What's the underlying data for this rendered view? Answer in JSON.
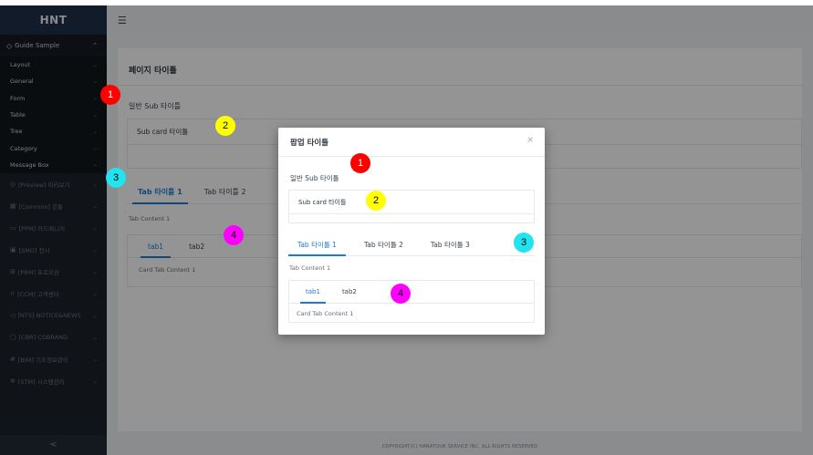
{
  "brand": {
    "name": "HNT"
  },
  "sidebar": {
    "top_label": "Guide Sample",
    "sub_items": [
      "Layout",
      "General",
      "Form",
      "Table",
      "Tree",
      "Category",
      "Message Box"
    ],
    "groups": [
      "[Preview] 미리보기",
      "[Common] 공통",
      "[PPM] 카드매니저",
      "[SMG] 전시",
      "[PRM] 프로모션",
      "[CCM] 고객센터",
      "[NTS] NOTICE&NEWS",
      "[CBR] COBRAND",
      "[BIM] 기초정보관리",
      "[STM] 시스템관리"
    ],
    "collapse_label": "<"
  },
  "page": {
    "title": "페이지 타이틀",
    "sub_title": "일반 Sub 타이틀",
    "sub_card_title": "Sub card 타이틀",
    "tabs": [
      "Tab 타이틀 1",
      "Tab 타이틀 2"
    ],
    "tab_content": "Tab Content 1",
    "card_tabs": [
      "tab1",
      "tab2"
    ],
    "card_tab_content": "Card Tab Content 1",
    "footer": "COPYRIGHT(C) HANATOUR SERVICE INC. ALL RIGHTS RESERVED"
  },
  "modal": {
    "title": "팝업 타이틀",
    "close": "×",
    "sub_title": "일반 Sub 타이틀",
    "sub_card_title": "Sub card 타이틀",
    "tabs": [
      "Tab 타이틀 1",
      "Tab 타이틀 2",
      "Tab 타이틀 3"
    ],
    "tab_content": "Tab Content 1",
    "card_tabs": [
      "tab1",
      "tab2"
    ],
    "card_tab_content": "Card Tab Content 1"
  },
  "markers": [
    "1",
    "2",
    "3",
    "4"
  ],
  "colors": {
    "accent": "#1f7ad6",
    "sidebar_bg": "#1c2129",
    "marker_red": "#ff0000",
    "marker_yellow": "#ffff00",
    "marker_cyan": "#22e3ee",
    "marker_magenta": "#ff00ff"
  }
}
